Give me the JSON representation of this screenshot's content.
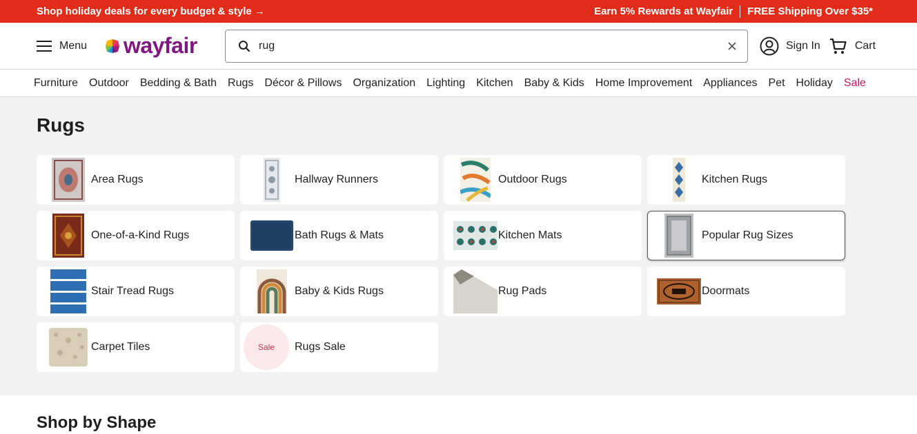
{
  "promo": {
    "left_text": "Shop holiday deals for every budget & style →",
    "rewards": "Earn 5% Rewards at Wayfair",
    "shipping": "FREE Shipping Over $35*"
  },
  "header": {
    "menu_label": "Menu",
    "logo_text": "wayfair",
    "search_value": "rug",
    "sign_in": "Sign In",
    "cart": "Cart"
  },
  "nav": [
    {
      "label": "Furniture"
    },
    {
      "label": "Outdoor"
    },
    {
      "label": "Bedding & Bath"
    },
    {
      "label": "Rugs"
    },
    {
      "label": "Décor & Pillows"
    },
    {
      "label": "Organization"
    },
    {
      "label": "Lighting"
    },
    {
      "label": "Kitchen"
    },
    {
      "label": "Baby & Kids"
    },
    {
      "label": "Home Improvement"
    },
    {
      "label": "Appliances"
    },
    {
      "label": "Pet"
    },
    {
      "label": "Holiday"
    },
    {
      "label": "Sale"
    }
  ],
  "page_title": "Rugs",
  "categories": [
    {
      "label": "Area Rugs"
    },
    {
      "label": "Hallway Runners"
    },
    {
      "label": "Outdoor Rugs"
    },
    {
      "label": "Kitchen Rugs"
    },
    {
      "label": "One-of-a-Kind Rugs"
    },
    {
      "label": "Bath Rugs & Mats"
    },
    {
      "label": "Kitchen Mats"
    },
    {
      "label": "Popular Rug Sizes"
    },
    {
      "label": "Stair Tread Rugs"
    },
    {
      "label": "Baby & Kids Rugs"
    },
    {
      "label": "Rug Pads"
    },
    {
      "label": "Doormats"
    },
    {
      "label": "Carpet Tiles"
    },
    {
      "label": "Rugs Sale",
      "badge": "Sale"
    }
  ],
  "shop_by_shape": "Shop by Shape",
  "colors": {
    "promo_bg": "#e02c18",
    "brand": "#7f187f",
    "sale": "#c2185b"
  }
}
